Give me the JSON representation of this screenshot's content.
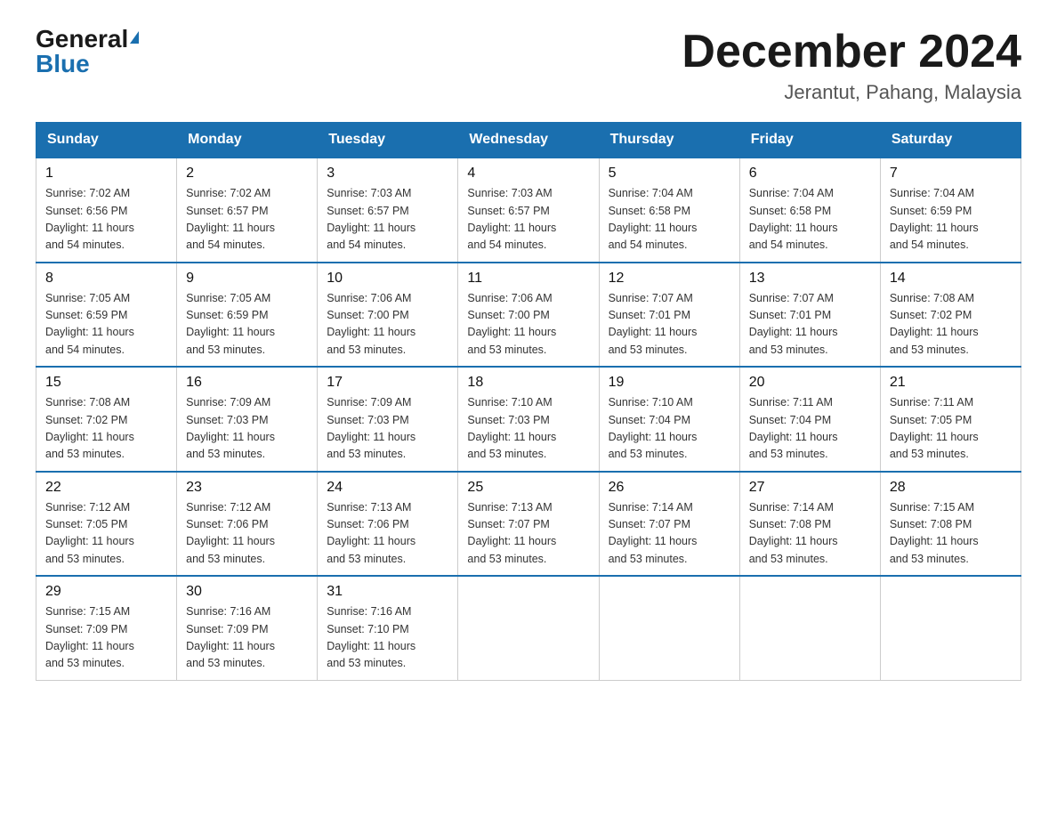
{
  "logo": {
    "general": "General",
    "triangle": "▶",
    "blue": "Blue"
  },
  "header": {
    "month_title": "December 2024",
    "location": "Jerantut, Pahang, Malaysia"
  },
  "days_of_week": [
    "Sunday",
    "Monday",
    "Tuesday",
    "Wednesday",
    "Thursday",
    "Friday",
    "Saturday"
  ],
  "weeks": [
    [
      {
        "day": "1",
        "sunrise": "7:02 AM",
        "sunset": "6:56 PM",
        "daylight": "11 hours and 54 minutes."
      },
      {
        "day": "2",
        "sunrise": "7:02 AM",
        "sunset": "6:57 PM",
        "daylight": "11 hours and 54 minutes."
      },
      {
        "day": "3",
        "sunrise": "7:03 AM",
        "sunset": "6:57 PM",
        "daylight": "11 hours and 54 minutes."
      },
      {
        "day": "4",
        "sunrise": "7:03 AM",
        "sunset": "6:57 PM",
        "daylight": "11 hours and 54 minutes."
      },
      {
        "day": "5",
        "sunrise": "7:04 AM",
        "sunset": "6:58 PM",
        "daylight": "11 hours and 54 minutes."
      },
      {
        "day": "6",
        "sunrise": "7:04 AM",
        "sunset": "6:58 PM",
        "daylight": "11 hours and 54 minutes."
      },
      {
        "day": "7",
        "sunrise": "7:04 AM",
        "sunset": "6:59 PM",
        "daylight": "11 hours and 54 minutes."
      }
    ],
    [
      {
        "day": "8",
        "sunrise": "7:05 AM",
        "sunset": "6:59 PM",
        "daylight": "11 hours and 54 minutes."
      },
      {
        "day": "9",
        "sunrise": "7:05 AM",
        "sunset": "6:59 PM",
        "daylight": "11 hours and 53 minutes."
      },
      {
        "day": "10",
        "sunrise": "7:06 AM",
        "sunset": "7:00 PM",
        "daylight": "11 hours and 53 minutes."
      },
      {
        "day": "11",
        "sunrise": "7:06 AM",
        "sunset": "7:00 PM",
        "daylight": "11 hours and 53 minutes."
      },
      {
        "day": "12",
        "sunrise": "7:07 AM",
        "sunset": "7:01 PM",
        "daylight": "11 hours and 53 minutes."
      },
      {
        "day": "13",
        "sunrise": "7:07 AM",
        "sunset": "7:01 PM",
        "daylight": "11 hours and 53 minutes."
      },
      {
        "day": "14",
        "sunrise": "7:08 AM",
        "sunset": "7:02 PM",
        "daylight": "11 hours and 53 minutes."
      }
    ],
    [
      {
        "day": "15",
        "sunrise": "7:08 AM",
        "sunset": "7:02 PM",
        "daylight": "11 hours and 53 minutes."
      },
      {
        "day": "16",
        "sunrise": "7:09 AM",
        "sunset": "7:03 PM",
        "daylight": "11 hours and 53 minutes."
      },
      {
        "day": "17",
        "sunrise": "7:09 AM",
        "sunset": "7:03 PM",
        "daylight": "11 hours and 53 minutes."
      },
      {
        "day": "18",
        "sunrise": "7:10 AM",
        "sunset": "7:03 PM",
        "daylight": "11 hours and 53 minutes."
      },
      {
        "day": "19",
        "sunrise": "7:10 AM",
        "sunset": "7:04 PM",
        "daylight": "11 hours and 53 minutes."
      },
      {
        "day": "20",
        "sunrise": "7:11 AM",
        "sunset": "7:04 PM",
        "daylight": "11 hours and 53 minutes."
      },
      {
        "day": "21",
        "sunrise": "7:11 AM",
        "sunset": "7:05 PM",
        "daylight": "11 hours and 53 minutes."
      }
    ],
    [
      {
        "day": "22",
        "sunrise": "7:12 AM",
        "sunset": "7:05 PM",
        "daylight": "11 hours and 53 minutes."
      },
      {
        "day": "23",
        "sunrise": "7:12 AM",
        "sunset": "7:06 PM",
        "daylight": "11 hours and 53 minutes."
      },
      {
        "day": "24",
        "sunrise": "7:13 AM",
        "sunset": "7:06 PM",
        "daylight": "11 hours and 53 minutes."
      },
      {
        "day": "25",
        "sunrise": "7:13 AM",
        "sunset": "7:07 PM",
        "daylight": "11 hours and 53 minutes."
      },
      {
        "day": "26",
        "sunrise": "7:14 AM",
        "sunset": "7:07 PM",
        "daylight": "11 hours and 53 minutes."
      },
      {
        "day": "27",
        "sunrise": "7:14 AM",
        "sunset": "7:08 PM",
        "daylight": "11 hours and 53 minutes."
      },
      {
        "day": "28",
        "sunrise": "7:15 AM",
        "sunset": "7:08 PM",
        "daylight": "11 hours and 53 minutes."
      }
    ],
    [
      {
        "day": "29",
        "sunrise": "7:15 AM",
        "sunset": "7:09 PM",
        "daylight": "11 hours and 53 minutes."
      },
      {
        "day": "30",
        "sunrise": "7:16 AM",
        "sunset": "7:09 PM",
        "daylight": "11 hours and 53 minutes."
      },
      {
        "day": "31",
        "sunrise": "7:16 AM",
        "sunset": "7:10 PM",
        "daylight": "11 hours and 53 minutes."
      },
      null,
      null,
      null,
      null
    ]
  ],
  "labels": {
    "sunrise": "Sunrise:",
    "sunset": "Sunset:",
    "daylight": "Daylight:"
  }
}
